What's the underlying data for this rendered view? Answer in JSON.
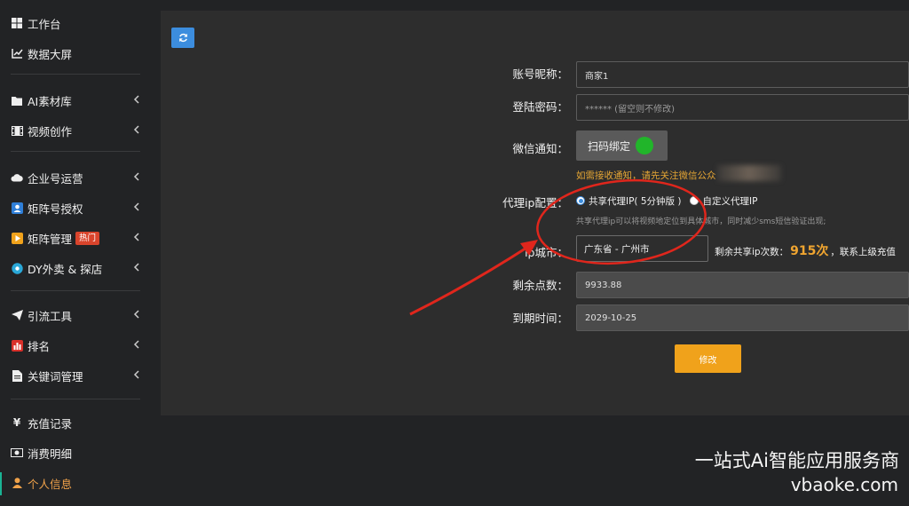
{
  "sidebar": {
    "items": [
      {
        "label": "工作台",
        "icon": "windows-icon",
        "chevron": false
      },
      {
        "label": "数据大屏",
        "icon": "line-chart-icon",
        "chevron": false
      },
      {
        "label": "AI素材库",
        "icon": "folder-icon",
        "chevron": true
      },
      {
        "label": "视频创作",
        "icon": "film-icon",
        "chevron": true
      },
      {
        "label": "企业号运营",
        "icon": "cloud-icon",
        "chevron": true
      },
      {
        "label": "矩阵号授权",
        "icon": "user-badge-icon",
        "chevron": true
      },
      {
        "label": "矩阵管理",
        "icon": "video-badge-icon",
        "chevron": true,
        "badge": "热门"
      },
      {
        "label": "DY外卖 & 探店",
        "icon": "disc-icon",
        "chevron": true
      },
      {
        "label": "引流工具",
        "icon": "paper-plane-icon",
        "chevron": true
      },
      {
        "label": "排名",
        "icon": "bar-chart-icon",
        "chevron": true
      },
      {
        "label": "关键词管理",
        "icon": "document-icon",
        "chevron": true
      },
      {
        "label": "充值记录",
        "icon": "yen-icon",
        "chevron": false
      },
      {
        "label": "消费明细",
        "icon": "money-icon",
        "chevron": false
      },
      {
        "label": "个人信息",
        "icon": "user-icon",
        "chevron": false,
        "active": true
      }
    ]
  },
  "form": {
    "nickname_label": "账号昵称：",
    "nickname_value": "商家1",
    "password_label": "登陆密码：",
    "password_placeholder": "****** (留空则不修改)",
    "wechat_label": "微信通知：",
    "scan_button": "扫码绑定",
    "notice": "如需接收通知，请先关注微信公众",
    "proxy_label": "代理ip配置：",
    "proxy_options": [
      "共享代理IP( 5分钟版 )",
      "自定义代理IP"
    ],
    "proxy_hint": "共享代理ip可以将视频地定位到具体城市，同时减少sms短信验证出现;",
    "city_label": "ip城市：",
    "city_value": "广东省 - 广州市",
    "remain_prefix": "剩余共享ip次数：",
    "remain_value": "915次",
    "remain_suffix": "，联系上级充值",
    "points_label": "剩余点数：",
    "points_value": "9933.88",
    "expire_label": "到期时间：",
    "expire_value": "2029-10-25",
    "submit": "修改"
  },
  "watermark": {
    "line1": "一站式Ai智能应用服务商",
    "line2": "vbaoke.com"
  },
  "colors": {
    "accent_orange": "#f0a21b",
    "refresh_blue": "#3c8dde",
    "active_green": "#1ab394",
    "annotation_red": "#e0261c"
  }
}
